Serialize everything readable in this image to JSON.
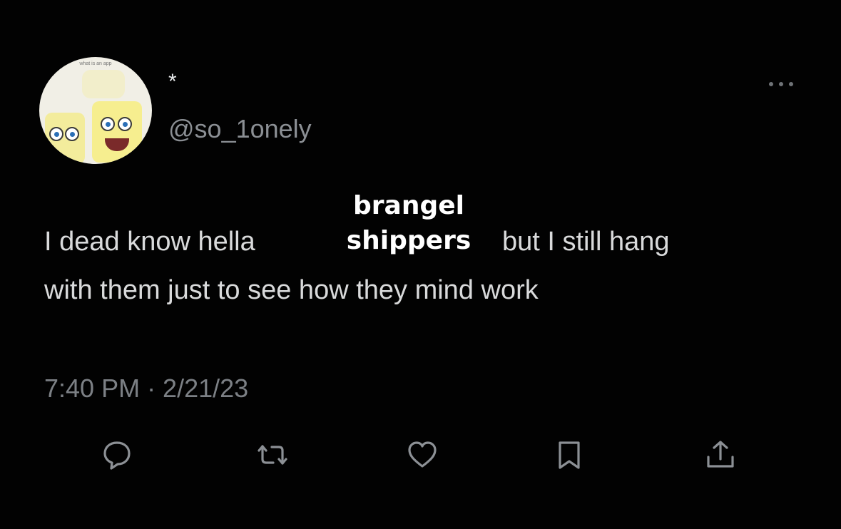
{
  "avatar": {
    "caption": "what is an app"
  },
  "user": {
    "display_name": "*",
    "handle": "@so_1onely"
  },
  "tweet": {
    "line1_start": "I dead know hella",
    "line1_end": "but I still hang",
    "line2": "with them just to see how they mind work",
    "overlay_line1": "brangel",
    "overlay_line2": "shippers",
    "timestamp": "7:40 PM · 2/21/23"
  },
  "icons": {
    "more": "more-icon",
    "reply": "reply-icon",
    "retweet": "retweet-icon",
    "like": "like-icon",
    "bookmark": "bookmark-icon",
    "share": "share-icon"
  },
  "colors": {
    "background": "#020202",
    "text": "#d9dadb",
    "muted": "#7c8085",
    "icon": "#8c9095"
  }
}
